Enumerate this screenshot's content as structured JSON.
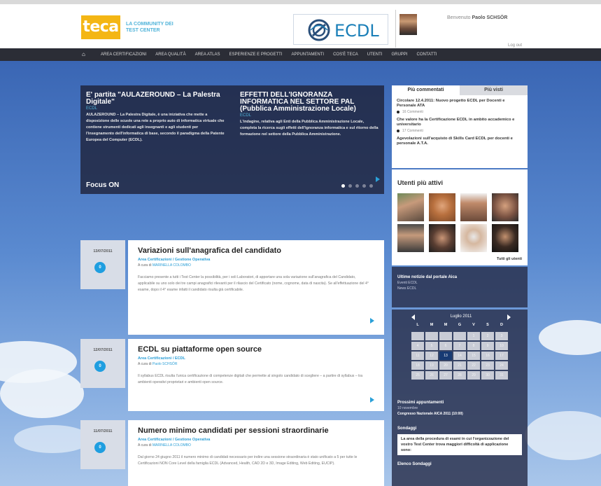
{
  "header": {
    "logo_text": "teca",
    "tagline": "LA COMMUNITY DEI TEST CENTER",
    "partner_logo_text": "ECDL",
    "welcome_prefix": "Benvenuto",
    "user_name": "Paolo SCHSÖR",
    "logout_label": "Log out"
  },
  "nav": {
    "home_icon": "home-icon",
    "items": [
      "AREA CERTIFICAZIONI",
      "AREA QUALITÀ",
      "AREA ATLAS",
      "ESPERIENZE E PROGETTI",
      "APPUNTAMENTI",
      "COS'È TECA",
      "UTENTI",
      "GRUPPI",
      "CONTATTI"
    ]
  },
  "slider": {
    "focus_label": "Focus ON",
    "slides": [
      {
        "title": "E' partita \"AULAZEROUND – La Palestra Digitale\"",
        "category": "ECDL",
        "body": "AULAZEROUND – La Palestra Digitale, è una iniziativa che mette a disposizione delle scuole una rete a proprio auto di informatica virtuale che contiene strumenti dedicati agli insegnanti e agli studenti per l'insegnamento dell'informatica di base, secondo il paradigma della Patente Europea del Computer (ECDL)."
      },
      {
        "title": "EFFETTI DELL'IGNORANZA INFORMATICA NEL SETTORE PAL (Pubblica Amministrazione Locale)",
        "category": "ECDL",
        "body": "L'indagine, relativa agli Enti della Pubblica Amministrazione Locale, completa la ricerca sugli effetti dell'ignoranza informatica e sul ritorno della formazione nel settore della Pubblica Amministrazione."
      }
    ],
    "active_dot": 0,
    "dot_count": 5
  },
  "sidebar": {
    "tabs": [
      "Più commentati",
      "Più visti"
    ],
    "commented": [
      {
        "title": "Circolare 12.4.2011: Nuovo progetto ECDL per Docenti e Personale ATA",
        "count": "16 Commenti"
      },
      {
        "title": "Che valore ha la Certificazione ECDL in ambito accademico e universitario",
        "count": "17 Commenti"
      },
      {
        "title": "Agevolazioni sull'acquisto di Skills Card ECDL per docenti e personale A.T.A.",
        "count": ""
      }
    ],
    "active_users_title": "Utenti più attivi",
    "all_users_label": "Tutti gli utenti",
    "news_title": "Ultime notizie dal portale Aica",
    "news_items": [
      "Eventi ECDL",
      "News ECDL"
    ],
    "calendar": {
      "month": "Luglio 2011",
      "days_of_week": [
        "L",
        "M",
        "M",
        "G",
        "V",
        "S",
        "D"
      ],
      "weeks": [
        [
          "",
          "",
          "",
          "",
          "1",
          "2",
          "3"
        ],
        [
          "4",
          "5",
          "6",
          "7",
          "8",
          "9",
          "10"
        ],
        [
          "11",
          "12",
          "13",
          "14",
          "15",
          "16",
          "17"
        ],
        [
          "18",
          "19",
          "20",
          "21",
          "22",
          "23",
          "24"
        ],
        [
          "25",
          "26",
          "27",
          "28",
          "29",
          "30",
          "31"
        ]
      ],
      "today": "13"
    },
    "events_title": "Prossimi appuntamenti",
    "event_date": "10 novembre",
    "event_name": "Congresso Nazionale AICA 2011 (10:00)",
    "survey_title": "Sondaggi",
    "survey_question": "La area della procedura di esami in cui l'organizzazione del vostro Test Center trova maggiori difficoltà di applicazione sono:",
    "survey_list_label": "Elenco Sondaggi"
  },
  "news": [
    {
      "date": "13/07/2011",
      "comments": "0",
      "title": "Variazioni sull'anagrafica del candidato",
      "category": "Area Certificazioni / Gestione Operativa",
      "author_prefix": "A cura di",
      "author": "MARINELLA COLOMBO",
      "body": "Facciamo presente a tutti i Test Center la possibilità, per i soli Laboratori, di apportare una sola variazione sull'anagrafica del Candidato, applicabile su uno solo dei tre campi anagrafici rilevanti per il rilascio del Certificato (nome, cognome, data di nascita). Se all'effettuazione del 4° esame, dopo il 4° esame infatti il candidato risulta già certificabile."
    },
    {
      "date": "12/07/2011",
      "comments": "0",
      "title": "ECDL su piattaforme open source",
      "category": "Area Certificazioni / ECDL",
      "author_prefix": "A cura di",
      "author": "Paolo SCHSÖR",
      "body": "Il syllabus ECDL risulta l'unica certificazione di competenze digitali che permette al singolo candidato di scegliere – a partire di syllabus – tra ambienti operativi proprietari e ambienti open source."
    },
    {
      "date": "11/07/2011",
      "comments": "0",
      "title": "Numero minimo candidati per sessioni straordinarie",
      "category": "Area Certificazioni / Gestione Operativa",
      "author_prefix": "A cura di",
      "author": "MARINELLA COLOMBO",
      "body": "Dal giorno 24 giugno 2011 il numero minimo di candidati necessario per indire una sessione straordinaria è stato unificato a 5 per tutte le Certificazioni NON Core Level della famiglia ECDL (Advanced, Health, CAD 2D e 3D, Image Editing, Web Editing, EUCIP)."
    }
  ]
}
